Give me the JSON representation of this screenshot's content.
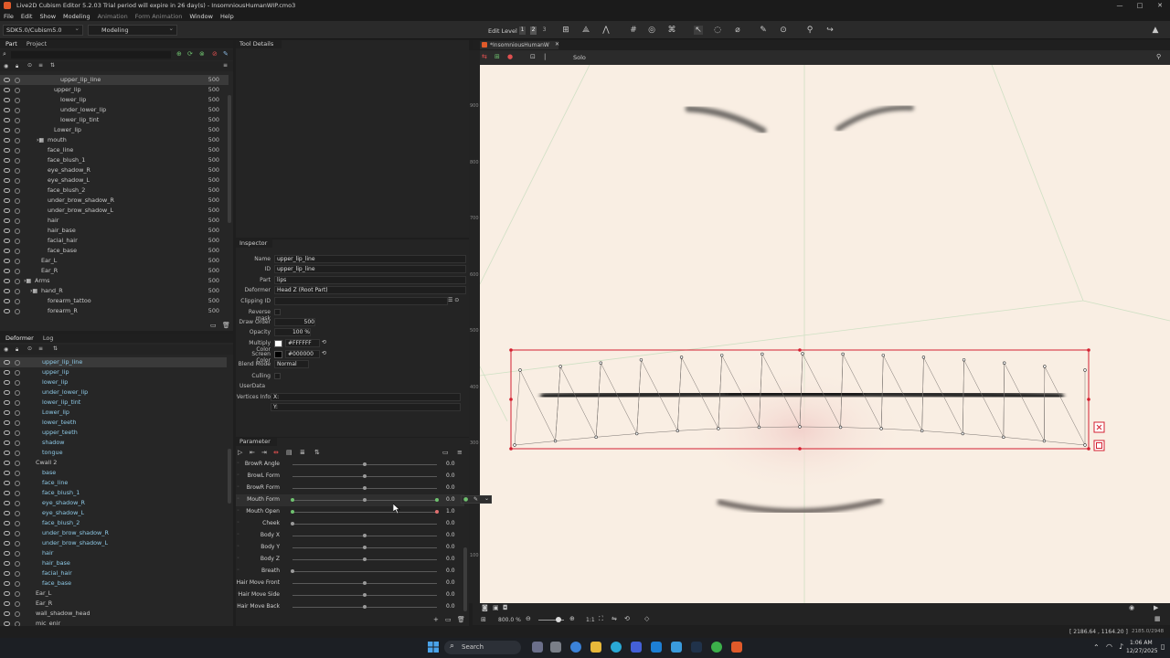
{
  "window": {
    "title": "Live2D Cubism Editor 5.2.03   Trial period will expire in 26 day(s)  -  InsomniousHumanWIP.cmo3",
    "controls": [
      "—",
      "□",
      "✕"
    ]
  },
  "menu": [
    "File",
    "Edit",
    "Show",
    "Modeling",
    "Animation",
    "Form Animation",
    "Window",
    "Help"
  ],
  "toolbar": {
    "sdk": "SDK5.0/Cubism5.0",
    "mode": "Modeling",
    "edit_level_label": "Edit Level",
    "edit_levels": [
      "1",
      "2",
      "3"
    ]
  },
  "part_panel": {
    "tabs": [
      "Part",
      "Project"
    ],
    "rows": [
      {
        "name": "upper_lip_line",
        "value": "500",
        "indent": 2,
        "selected": true
      },
      {
        "name": "upper_lip",
        "value": "500",
        "indent": 1
      },
      {
        "name": "lower_lip",
        "value": "500",
        "indent": 2
      },
      {
        "name": "under_lower_lip",
        "value": "500",
        "indent": 2
      },
      {
        "name": "lower_lip_tint",
        "value": "500",
        "indent": 2
      },
      {
        "name": "Lower_lip",
        "value": "500",
        "indent": 1
      },
      {
        "name": "mouth",
        "value": "500",
        "indent": 0,
        "folder": true
      },
      {
        "name": "face_line",
        "value": "500",
        "indent": 0
      },
      {
        "name": "face_blush_1",
        "value": "500",
        "indent": 0
      },
      {
        "name": "eye_shadow_R",
        "value": "500",
        "indent": 0
      },
      {
        "name": "eye_shadow_L",
        "value": "500",
        "indent": 0
      },
      {
        "name": "face_blush_2",
        "value": "500",
        "indent": 0
      },
      {
        "name": "under_brow_shadow_R",
        "value": "500",
        "indent": 0
      },
      {
        "name": "under_brow_shadow_L",
        "value": "500",
        "indent": 0
      },
      {
        "name": "hair",
        "value": "500",
        "indent": 0
      },
      {
        "name": "hair_base",
        "value": "500",
        "indent": 0
      },
      {
        "name": "facial_hair",
        "value": "500",
        "indent": 0
      },
      {
        "name": "face_base",
        "value": "500",
        "indent": 0
      },
      {
        "name": "Ear_L",
        "value": "500",
        "indent": -1
      },
      {
        "name": "Ear_R",
        "value": "500",
        "indent": -1
      },
      {
        "name": "Arms",
        "value": "500",
        "indent": -2,
        "folder": true
      },
      {
        "name": "hand_R",
        "value": "500",
        "indent": -1,
        "folder": true
      },
      {
        "name": "forearm_tattoo",
        "value": "500",
        "indent": 0
      },
      {
        "name": "forearm_R",
        "value": "500",
        "indent": 0
      }
    ]
  },
  "deformer_panel": {
    "tabs": [
      "Deformer",
      "Log"
    ],
    "rows": [
      {
        "name": "upper_lip_line",
        "indent": 0,
        "selected": true
      },
      {
        "name": "upper_lip",
        "indent": 0
      },
      {
        "name": "lower_lip",
        "indent": 0
      },
      {
        "name": "under_lower_lip",
        "indent": 0
      },
      {
        "name": "lower_lip_tint",
        "indent": 0
      },
      {
        "name": "Lower_lip",
        "indent": 0
      },
      {
        "name": "lower_teeth",
        "indent": 0
      },
      {
        "name": "upper_teeth",
        "indent": 0
      },
      {
        "name": "shadow",
        "indent": 0
      },
      {
        "name": "tongue",
        "indent": 0
      },
      {
        "name": "Cwall 2",
        "indent": -1
      },
      {
        "name": "base",
        "indent": 0
      },
      {
        "name": "face_line",
        "indent": 0
      },
      {
        "name": "face_blush_1",
        "indent": 0
      },
      {
        "name": "eye_shadow_R",
        "indent": 0
      },
      {
        "name": "eye_shadow_L",
        "indent": 0
      },
      {
        "name": "face_blush_2",
        "indent": 0
      },
      {
        "name": "under_brow_shadow_R",
        "indent": 0
      },
      {
        "name": "under_brow_shadow_L",
        "indent": 0
      },
      {
        "name": "hair",
        "indent": 0
      },
      {
        "name": "hair_base",
        "indent": 0
      },
      {
        "name": "facial_hair",
        "indent": 0
      },
      {
        "name": "face_base",
        "indent": 0
      },
      {
        "name": "Ear_L",
        "indent": -1
      },
      {
        "name": "Ear_R",
        "indent": -1
      },
      {
        "name": "wall_shadow_head",
        "indent": -1
      },
      {
        "name": "mic_enir",
        "indent": -1
      }
    ]
  },
  "tool_details": {
    "title": "Tool Details"
  },
  "inspector": {
    "title": "Inspector",
    "fields": [
      {
        "label": "Name",
        "value": "upper_lip_line"
      },
      {
        "label": "ID",
        "value": "upper_lip_line"
      },
      {
        "label": "Part",
        "value": "lips"
      },
      {
        "label": "Deformer",
        "value": "Head Z (Root Part)"
      },
      {
        "label": "Clipping ID",
        "value": ""
      },
      {
        "label": "Reverse mask",
        "value": ""
      },
      {
        "label": "Draw Order",
        "value": "500"
      },
      {
        "label": "Opacity",
        "value": "100 %"
      },
      {
        "label": "Multiply Color",
        "value": "#FFFFFF"
      },
      {
        "label": "Screen Color",
        "value": "#000000"
      },
      {
        "label": "Blend Mode",
        "value": "Normal"
      },
      {
        "label": "Culling",
        "value": ""
      },
      {
        "label": "UserData",
        "value": ""
      },
      {
        "label": "Vertices Info",
        "value": "X:"
      },
      {
        "label": "",
        "value": "Y:"
      }
    ]
  },
  "parameter": {
    "title": "Parameter",
    "rows": [
      {
        "label": "BrowR Angle",
        "value": "0.0",
        "pos": 0.5
      },
      {
        "label": "BrowL Form",
        "value": "0.0",
        "pos": 0.5
      },
      {
        "label": "BrowR Form",
        "value": "0.0",
        "pos": 0.5
      },
      {
        "label": "Mouth Form",
        "value": "0.0",
        "pos": 0.5,
        "active": true
      },
      {
        "label": "Mouth Open",
        "value": "1.0",
        "pos": 1.0
      },
      {
        "label": "Cheek",
        "value": "0.0",
        "pos": 0.0
      },
      {
        "label": "Body X",
        "value": "0.0",
        "pos": 0.5
      },
      {
        "label": "Body Y",
        "value": "0.0",
        "pos": 0.5
      },
      {
        "label": "Body Z",
        "value": "0.0",
        "pos": 0.5
      },
      {
        "label": "Breath",
        "value": "0.0",
        "pos": 0.0
      },
      {
        "label": "Hair Move Front",
        "value": "0.0",
        "pos": 0.5
      },
      {
        "label": "Hair Move Side",
        "value": "0.0",
        "pos": 0.5
      },
      {
        "label": "Hair Move Back",
        "value": "0.0",
        "pos": 0.5
      }
    ]
  },
  "viewport": {
    "tab": "*InsomniousHumanW",
    "solo_label": "Solo",
    "ruler_labels": [
      "900",
      "800",
      "700",
      "600",
      "500",
      "400",
      "300",
      "200",
      "100"
    ],
    "zoom": "800.0 %",
    "ratio": "1:1"
  },
  "status": {
    "coords": "[ 2186.64 , 1164.20 ]",
    "right": "2185.0/2948"
  },
  "taskbar": {
    "search_placeholder": "Search",
    "time": "1:06 AM",
    "date": "12/27/2025"
  },
  "colors": {
    "accent": "#e05a2a",
    "canvas_bg": "#f9eee3",
    "mesh_red": "#d42030",
    "panel_bg": "#262626"
  }
}
